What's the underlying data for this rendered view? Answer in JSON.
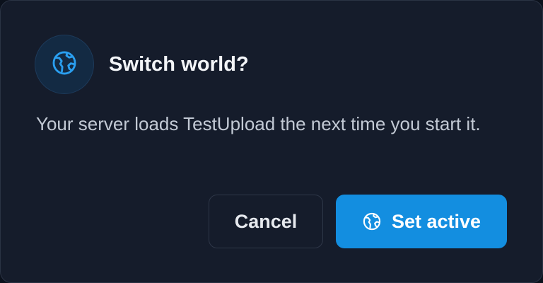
{
  "dialog": {
    "title": "Switch world?",
    "message": "Your server loads TestUpload the next time you start it.",
    "header_icon": "globe-icon",
    "cancel_label": "Cancel",
    "confirm_label": "Set active",
    "confirm_icon": "globe-icon"
  },
  "colors": {
    "background": "#151c2b",
    "accent": "#138ee0",
    "icon_tint": "#2a9ff0"
  }
}
